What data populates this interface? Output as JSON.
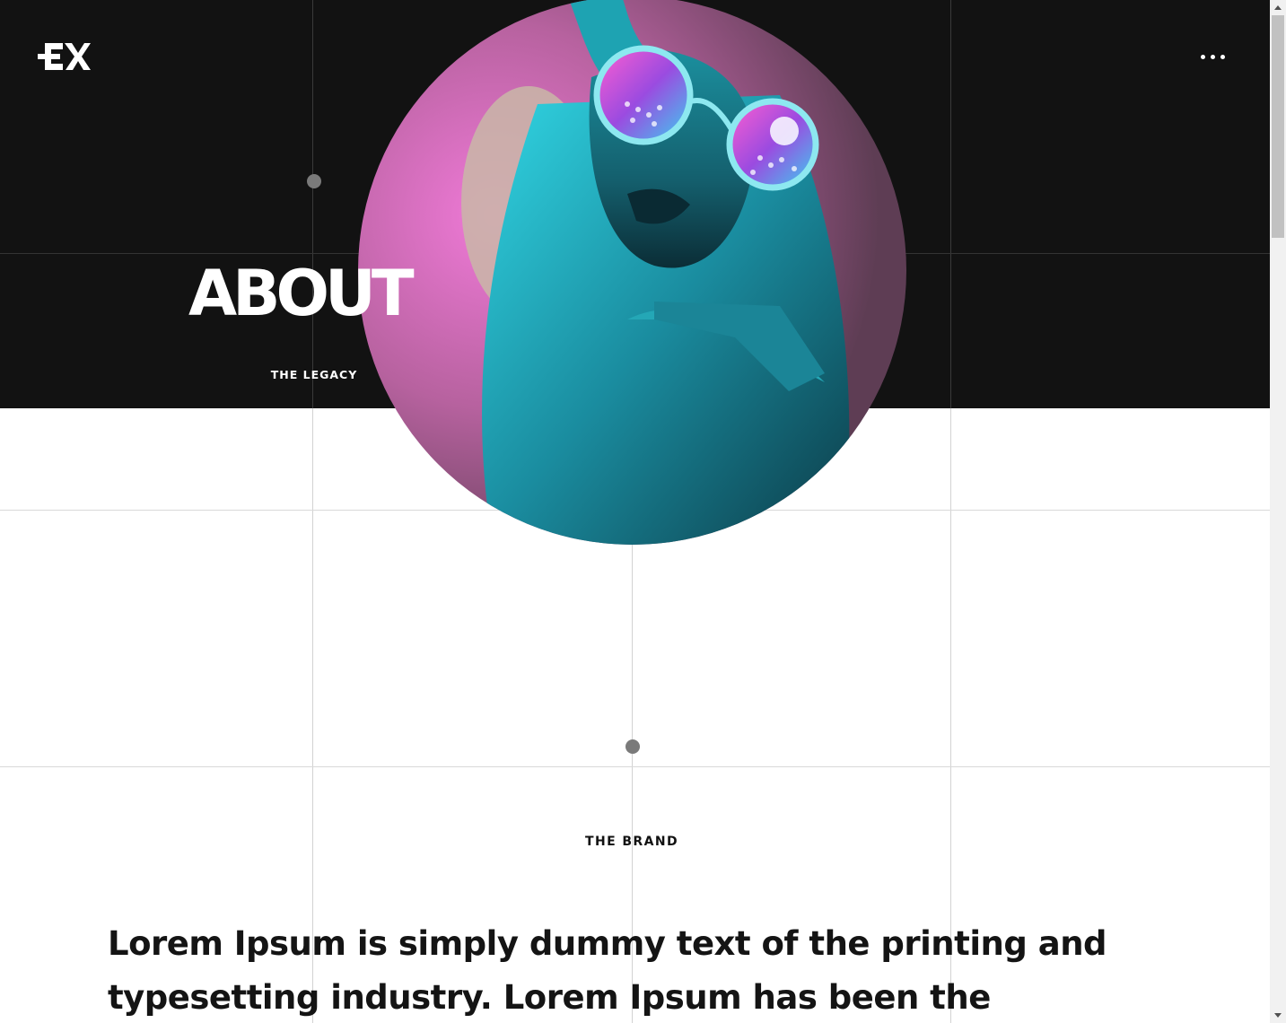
{
  "header": {
    "logo_alt": "EX",
    "menu_icon": "more-horizontal-icon"
  },
  "hero": {
    "title": "ABOUT",
    "subtitle": "THE LEGACY",
    "image": "portrait-woman-neon-sunglasses"
  },
  "section": {
    "label": "THE BRAND",
    "intro": "Lorem Ipsum is simply dummy text of the printing and typesetting industry. Lorem Ipsum has been the"
  },
  "colors": {
    "hero_background": "#121212",
    "accent_cyan": "#22c8d8",
    "accent_pink": "#e45fc6",
    "text_dark": "#141414"
  }
}
